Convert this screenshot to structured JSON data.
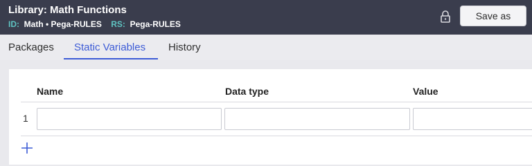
{
  "header": {
    "title": "Library: Math Functions",
    "id_label": "ID:",
    "id_value": "Math • Pega-RULES",
    "rs_label": "RS:",
    "rs_value": "Pega-RULES",
    "save_label": "Save as",
    "lock_icon": "lock-icon"
  },
  "tabs": [
    {
      "label": "Packages",
      "active": false
    },
    {
      "label": "Static Variables",
      "active": true
    },
    {
      "label": "History",
      "active": false
    }
  ],
  "table": {
    "columns": [
      "Name",
      "Data type",
      "Value"
    ],
    "rows": [
      {
        "number": "1",
        "name": "",
        "data_type": "",
        "value": ""
      }
    ],
    "add_icon": "plus-icon"
  },
  "colors": {
    "header_bg": "#3a3d4d",
    "accent": "#3c5bd6",
    "meta_label": "#5fc3c2"
  }
}
